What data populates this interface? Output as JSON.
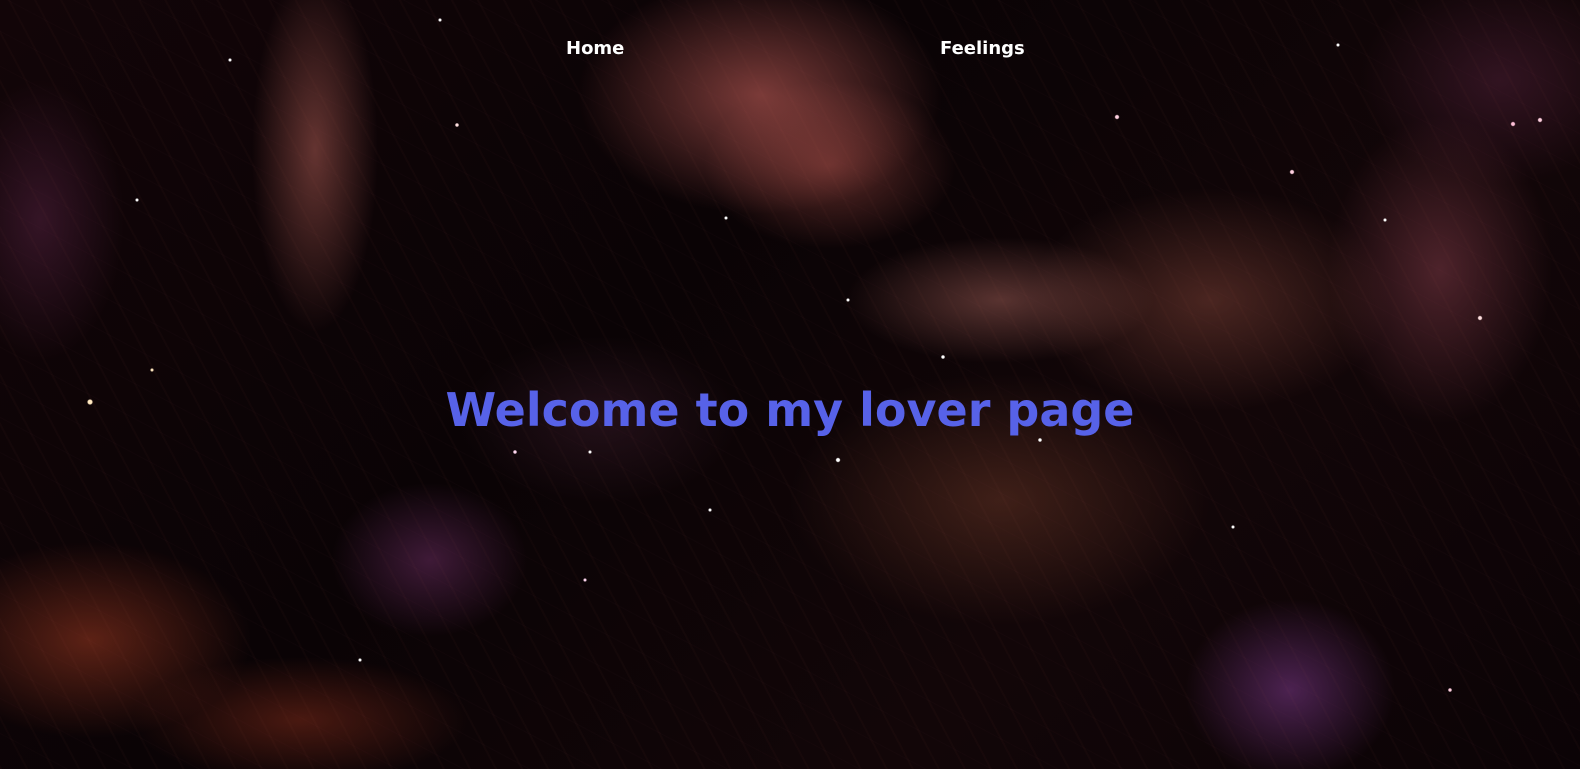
{
  "nav": {
    "items": [
      {
        "label": "Home"
      },
      {
        "label": "Feelings"
      }
    ]
  },
  "hero": {
    "title": "Welcome to my lover page"
  },
  "colors": {
    "nav_text": "#ffffff",
    "title": "#5762e8",
    "background": "#0a0305"
  },
  "background_image": "nebula-space-background"
}
